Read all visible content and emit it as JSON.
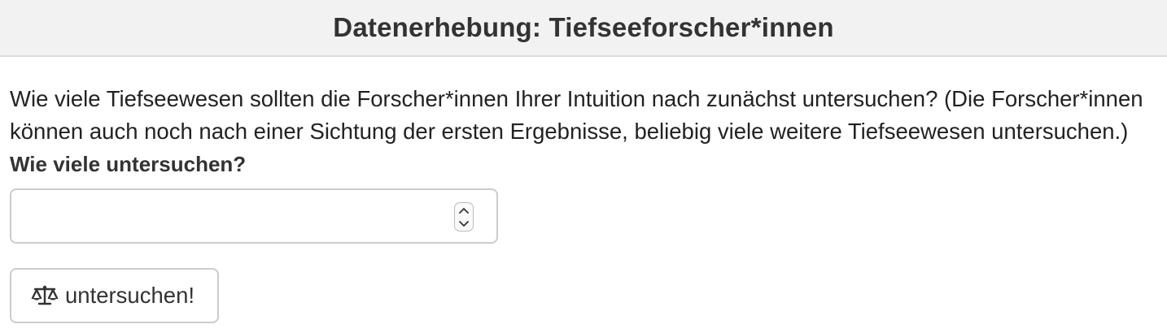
{
  "header": {
    "title": "Datenerhebung: Tiefseeforscher*innen"
  },
  "form": {
    "question_text": "Wie viele Tiefseewesen sollten die Forscher*innen Ihrer Intuition nach zunächst untersuchen? (Die Forscher*innen können auch noch nach einer Sichtung der ersten Ergebnisse, beliebig viele weitere Tiefseewesen untersuchen.)",
    "field_label": "Wie viele untersuchen?",
    "number_value": "",
    "submit_label": "untersuchen!",
    "submit_icon": "balance-scale-icon"
  },
  "colors": {
    "header_bg": "#f2f2f2",
    "border": "#cccccc",
    "text": "#333333"
  }
}
